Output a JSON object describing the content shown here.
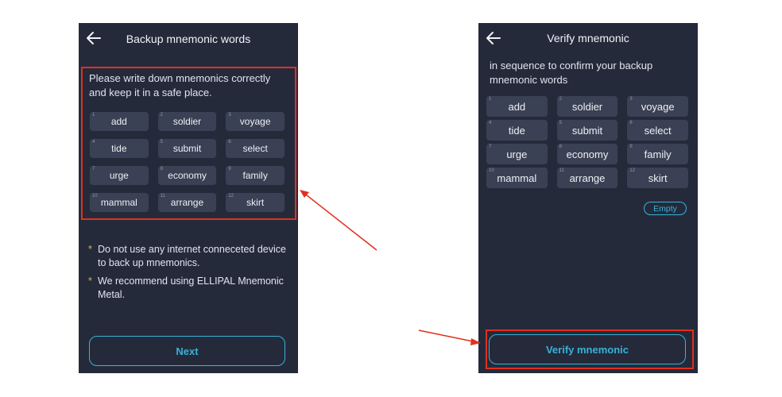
{
  "backup_screen": {
    "title": "Backup mnemonic words",
    "instruction": "Please write down mnemonics correctly and keep it in a safe place.",
    "words": [
      {
        "num": "1",
        "word": "add"
      },
      {
        "num": "2",
        "word": "soldier"
      },
      {
        "num": "3",
        "word": "voyage"
      },
      {
        "num": "4",
        "word": "tide"
      },
      {
        "num": "5",
        "word": "submit"
      },
      {
        "num": "6",
        "word": "select"
      },
      {
        "num": "7",
        "word": "urge"
      },
      {
        "num": "8",
        "word": "economy"
      },
      {
        "num": "9",
        "word": "family"
      },
      {
        "num": "10",
        "word": "mammal"
      },
      {
        "num": "11",
        "word": "arrange"
      },
      {
        "num": "12",
        "word": "skirt"
      }
    ],
    "notes": [
      {
        "bullet": "*",
        "text": "Do not use any internet conneceted device to back up mnemonics."
      },
      {
        "bullet": "*",
        "text": "We recommend using ELLIPAL Mnemonic Metal."
      }
    ],
    "next_label": "Next"
  },
  "verify_screen": {
    "title": "Verify mnemonic",
    "instruction": "in sequence to confirm your backup mnemonic words",
    "words": [
      {
        "num": "1",
        "word": "add"
      },
      {
        "num": "2",
        "word": "soldier"
      },
      {
        "num": "3",
        "word": "voyage"
      },
      {
        "num": "4",
        "word": "tide"
      },
      {
        "num": "5",
        "word": "submit"
      },
      {
        "num": "6",
        "word": "select"
      },
      {
        "num": "7",
        "word": "urge"
      },
      {
        "num": "8",
        "word": "economy"
      },
      {
        "num": "9",
        "word": "family"
      },
      {
        "num": "10",
        "word": "mammal"
      },
      {
        "num": "11",
        "word": "arrange"
      },
      {
        "num": "12",
        "word": "skirt"
      }
    ],
    "empty_label": "Empty",
    "verify_label": "Verify mnemonic"
  },
  "colors": {
    "screen_bg": "#252a3b",
    "word_bg": "#3b4154",
    "accent": "#36b3d6",
    "highlight_box": "#e0301e",
    "bullet": "#d9b64a"
  }
}
